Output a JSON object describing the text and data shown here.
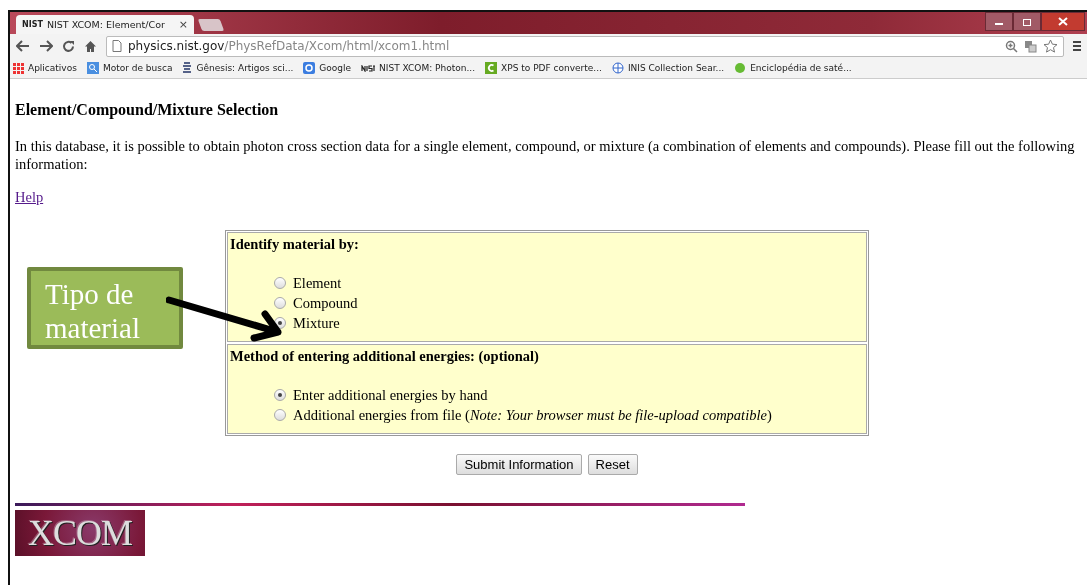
{
  "browser": {
    "tab": {
      "favicon": "NIST",
      "title": "NIST XCOM: Element/Cor",
      "close": "×"
    },
    "url": {
      "host": "physics.nist.gov",
      "path": "/PhysRefData/Xcom/html/xcom1.html"
    },
    "bookmarks": [
      {
        "kind": "apps",
        "label": "Aplicativos"
      },
      {
        "kind": "search",
        "label": "Motor de busca"
      },
      {
        "kind": "dna",
        "label": "Gênesis: Artigos sci..."
      },
      {
        "kind": "google",
        "label": "Google"
      },
      {
        "kind": "nist",
        "label": "NIST XCOM: Photon..."
      },
      {
        "kind": "c",
        "label": "XPS to PDF converte..."
      },
      {
        "kind": "globe",
        "label": "INIS Collection Sear..."
      },
      {
        "kind": "leaf",
        "label": "Enciclopédia de saté..."
      }
    ]
  },
  "page": {
    "heading": "Element/Compound/Mixture Selection",
    "intro": "In this database, it is possible to obtain photon cross section data for a single element, compound, or mixture (a combination of elements and compounds). Please fill out the following information:",
    "help_link": "Help",
    "sections": [
      {
        "title": "Identify material by:",
        "options": [
          {
            "label": "Element",
            "selected": false
          },
          {
            "label": "Compound",
            "selected": false
          },
          {
            "label": "Mixture",
            "selected": true
          }
        ]
      },
      {
        "title": "Method of entering additional energies: (optional)",
        "options": [
          {
            "label": "Enter additional energies by hand",
            "selected": true
          },
          {
            "label": "Additional energies from file (*Note: Your browser must be file-upload compatible*)",
            "selected": false
          }
        ]
      }
    ],
    "buttons": [
      "Submit Information",
      "Reset"
    ],
    "logo": "XCOM"
  },
  "callout": {
    "text": "Tipo de material"
  }
}
